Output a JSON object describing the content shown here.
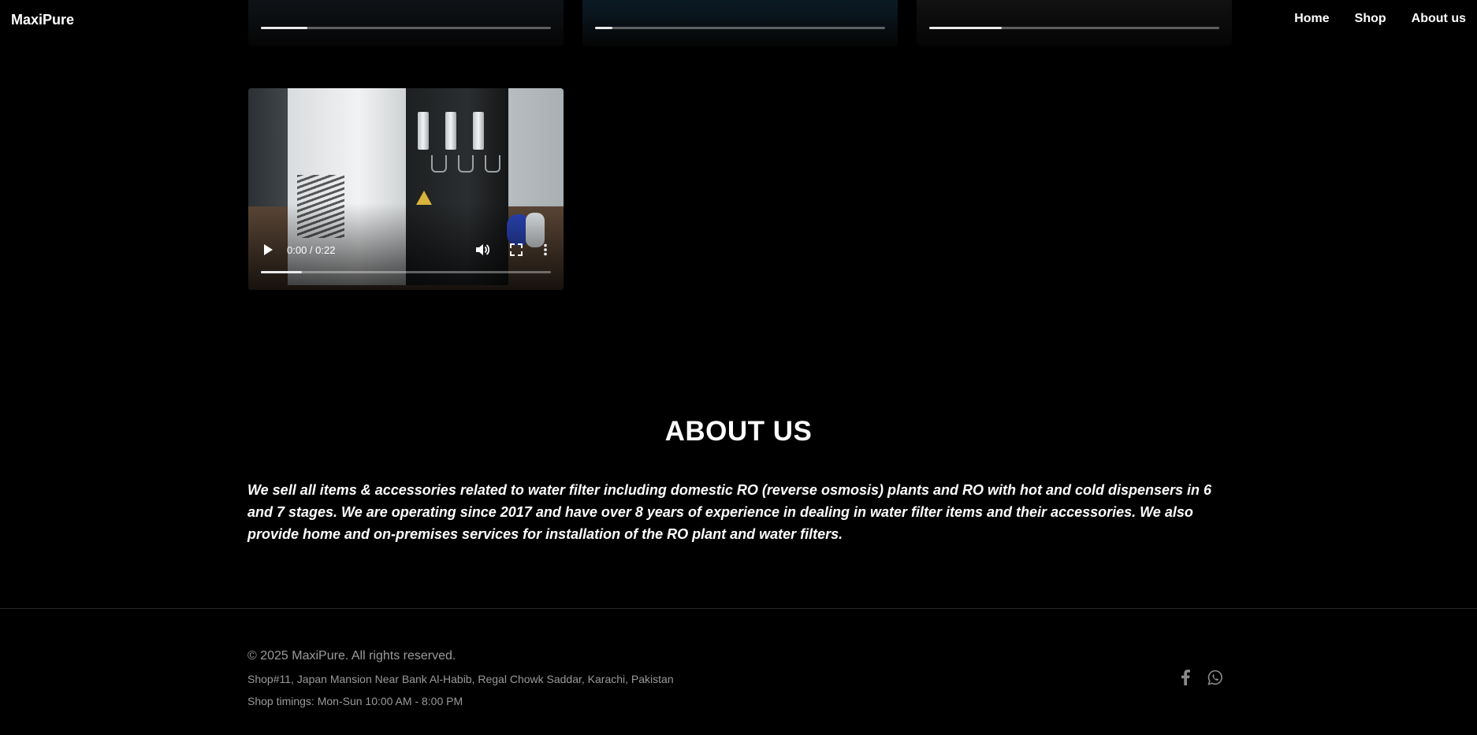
{
  "navbar": {
    "brand": "MaxiPure",
    "links": [
      "Home",
      "Shop",
      "About us"
    ]
  },
  "videos": [
    {
      "progress": 0.16
    },
    {
      "progress": 0.06
    },
    {
      "progress": 0.25
    },
    {
      "progress": 0.14,
      "time": "0:00 / 0:22"
    }
  ],
  "about": {
    "title": "ABOUT US",
    "body": "We sell all items & accessories related to water filter including domestic RO (reverse osmosis) plants and RO with hot and cold dispensers in 6 and 7 stages. We are operating since 2017 and have over 8 years of experience in dealing in water filter items and their accessories. We also provide home and on-premises services for installation of the RO plant and water filters."
  },
  "footer": {
    "copyright": "© 2025 MaxiPure. All rights reserved.",
    "address": "Shop#11, Japan Mansion Near Bank Al-Habib, Regal Chowk Saddar, Karachi, Pakistan",
    "hours": "Shop timings: Mon-Sun 10:00 AM - 8:00 PM",
    "social_icons": [
      "facebook-icon",
      "whatsapp-icon"
    ]
  },
  "colors": {
    "background": "#000000",
    "text": "#ffffff",
    "muted": "#9a9a9a"
  }
}
